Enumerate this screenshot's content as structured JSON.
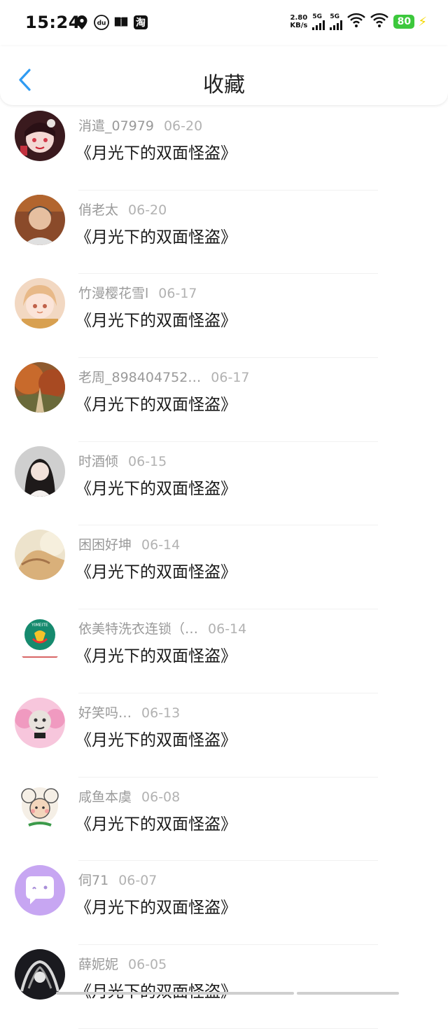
{
  "status_bar": {
    "time": "15:24",
    "net_speed_value": "2.80",
    "net_speed_unit": "KB/s",
    "signal1_label": "5G",
    "signal2_label": "5G",
    "battery_level": "80",
    "left_icons": [
      "location-icon",
      "du-app-icon",
      "book-icon",
      "taobao-icon"
    ],
    "taobao_glyph": "淘",
    "du_glyph": "du"
  },
  "header": {
    "title": "收藏",
    "back_icon": "chevron-left-icon",
    "accent_color": "#2f9bf2"
  },
  "favorites": [
    {
      "user": "消遣_07979",
      "date": "06-20",
      "work": "《月光下的双面怪盗》"
    },
    {
      "user": "俏老太",
      "date": "06-20",
      "work": "《月光下的双面怪盗》"
    },
    {
      "user": "竹漫樱花雪l",
      "date": "06-17",
      "work": "《月光下的双面怪盗》"
    },
    {
      "user": "老周_898404752…",
      "date": "06-17",
      "work": "《月光下的双面怪盗》"
    },
    {
      "user": "时酒倾",
      "date": "06-15",
      "work": "《月光下的双面怪盗》"
    },
    {
      "user": "困困好坤",
      "date": "06-14",
      "work": "《月光下的双面怪盗》"
    },
    {
      "user": "依美特洗衣连锁（…",
      "date": "06-14",
      "work": "《月光下的双面怪盗》"
    },
    {
      "user": "好笑吗…",
      "date": "06-13",
      "work": "《月光下的双面怪盗》"
    },
    {
      "user": "咸鱼本虞",
      "date": "06-08",
      "work": "《月光下的双面怪盗》"
    },
    {
      "user": "伺71",
      "date": "06-07",
      "work": "《月光下的双面怪盗》"
    },
    {
      "user": "薛妮妮",
      "date": "06-05",
      "work": "《月光下的双面怪盗》"
    }
  ],
  "avatar_icon": "avatar-icon",
  "yimeite_logo_text": "YIMEITE"
}
